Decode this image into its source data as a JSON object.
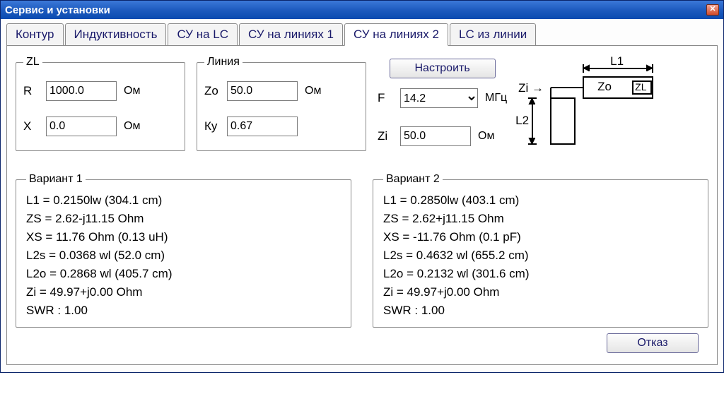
{
  "window": {
    "title": "Сервис и установки"
  },
  "tabs": {
    "items": [
      "Контур",
      "Индуктивность",
      "СУ на LC",
      "СУ на линиях 1",
      "СУ на линиях 2",
      "LC из линии"
    ],
    "active_index": 4
  },
  "zl": {
    "legend": "ZL",
    "r_label": "R",
    "r_value": "1000.0",
    "r_unit": "Ом",
    "x_label": "X",
    "x_value": "0.0",
    "x_unit": "Ом"
  },
  "line": {
    "legend": "Линия",
    "zo_label": "Zo",
    "zo_value": "50.0",
    "zo_unit": "Ом",
    "ku_label": "Ку",
    "ku_value": "0.67"
  },
  "controls": {
    "tune_btn": "Настроить",
    "f_label": "F",
    "f_value": "14.2",
    "f_unit": "МГц",
    "zi_label": "Zi",
    "zi_value": "50.0",
    "zi_unit": "Ом"
  },
  "diagram": {
    "l1": "L1",
    "l2": "L2",
    "zi": "Zi →",
    "zo": "Zo",
    "zl": "ZL"
  },
  "variant1": {
    "legend": "Вариант 1",
    "lines": [
      "L1 = 0.2150lw (304.1 cm)",
      "ZS = 2.62-j11.15 Ohm",
      "XS = 11.76 Ohm (0.13 uH)",
      "L2s = 0.0368 wl (52.0 cm)",
      "L2o = 0.2868 wl (405.7 cm)",
      "Zi = 49.97+j0.00 Ohm",
      "SWR : 1.00"
    ]
  },
  "variant2": {
    "legend": "Вариант 2",
    "lines": [
      "L1 = 0.2850lw (403.1 cm)",
      "ZS = 2.62+j11.15 Ohm",
      "XS = -11.76 Ohm (0.1 pF)",
      "L2s = 0.4632 wl (655.2 cm)",
      "L2o = 0.2132 wl (301.6 cm)",
      "Zi = 49.97+j0.00 Ohm",
      "SWR : 1.00"
    ]
  },
  "footer": {
    "cancel": "Отказ"
  }
}
